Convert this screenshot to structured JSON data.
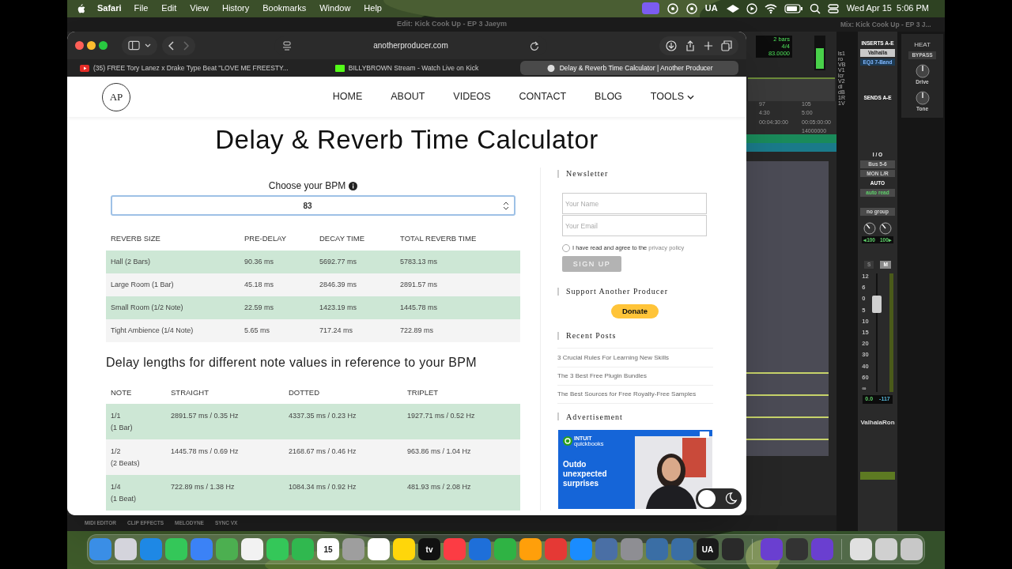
{
  "menu_bar": {
    "app": "Safari",
    "items": [
      "File",
      "Edit",
      "View",
      "History",
      "Bookmarks",
      "Window",
      "Help"
    ],
    "status_text": "UA",
    "clock": "Wed Apr 15  5:06 PM"
  },
  "daw": {
    "edit_title": "Edit: Kick Cook Up - EP 3 Jaeym",
    "mix_title": "Mix: Kick Cook Up - EP 3 J...",
    "counter": [
      "2 bars",
      "4/4",
      "83.0000"
    ],
    "ruler": [
      [
        "97",
        "105"
      ],
      [
        "4:30",
        "5:00"
      ],
      [
        "00:04:30:00",
        "00:05:00:00"
      ]
    ],
    "ruler_samples": "14000000",
    "track_fragments": [
      "ls1",
      "ro",
      "VB",
      "V1",
      "lcr",
      "V2",
      "dl",
      "dB",
      "1R",
      "1V"
    ],
    "inserts_header": "INSERTS A-E",
    "inserts": [
      "Valhalla",
      "EQ3 7-Band"
    ],
    "sends_header": "SENDS A-E",
    "io_header": "I / O",
    "io": [
      "Bus 5-6",
      "MON L/R"
    ],
    "auto_header": "AUTO",
    "auto": "auto read",
    "group": "no group",
    "pan": [
      "◂100",
      "100▸"
    ],
    "solo": "S",
    "mute": "M",
    "fader_scale": [
      "12",
      "6",
      "0",
      "5",
      "10",
      "15",
      "20",
      "30",
      "40",
      "60",
      "∞"
    ],
    "readout": [
      "0.0",
      "-117"
    ],
    "track_name": "ValhalaRon",
    "plugin": {
      "name": "HEAT",
      "bypass": "BYPASS",
      "knobs": [
        "Drive",
        "Tone"
      ]
    },
    "bottom_tabs": [
      "MIDI EDITOR",
      "CLIP EFFECTS",
      "MELODYNE",
      "SYNC VX"
    ]
  },
  "browser": {
    "address": "anotherproducer.com",
    "tabs": [
      {
        "kind": "video",
        "title": "(35) FREE Tory Lanez x Drake Type Beat \"LOVE ME FREESTY...",
        "selected": false
      },
      {
        "kind": "stream",
        "title": "BILLYBROWN Stream - Watch Live on Kick",
        "selected": false
      },
      {
        "kind": "site",
        "title": "Delay & Reverb Time Calculator | Another Producer",
        "selected": true
      }
    ]
  },
  "page": {
    "logo": "AP",
    "nav": [
      {
        "label": "HOME",
        "dropdown": false
      },
      {
        "label": "ABOUT",
        "dropdown": false
      },
      {
        "label": "VIDEOS",
        "dropdown": false
      },
      {
        "label": "CONTACT",
        "dropdown": false
      },
      {
        "label": "BLOG",
        "dropdown": false
      },
      {
        "label": "TOOLS",
        "dropdown": true
      }
    ],
    "title": "Delay & Reverb Time Calculator",
    "bpm": {
      "label": "Choose your BPM",
      "value": "83"
    },
    "reverb_table": {
      "columns": [
        "REVERB SIZE",
        "PRE-DELAY",
        "DECAY TIME",
        "TOTAL REVERB TIME"
      ],
      "rows": [
        [
          "Hall (2 Bars)",
          "90.36 ms",
          "5692.77 ms",
          "5783.13 ms"
        ],
        [
          "Large Room (1 Bar)",
          "45.18 ms",
          "2846.39 ms",
          "2891.57 ms"
        ],
        [
          "Small Room (1/2 Note)",
          "22.59 ms",
          "1423.19 ms",
          "1445.78 ms"
        ],
        [
          "Tight Ambience (1/4 Note)",
          "5.65 ms",
          "717.24 ms",
          "722.89 ms"
        ]
      ]
    },
    "delay_heading": "Delay lengths for different note values in reference to your BPM",
    "delay_table": {
      "columns": [
        "NOTE",
        "STRAIGHT",
        "DOTTED",
        "TRIPLET"
      ],
      "rows": [
        [
          "1/1\n(1 Bar)",
          "2891.57 ms / 0.35 Hz",
          "4337.35 ms / 0.23 Hz",
          "1927.71 ms / 0.52 Hz"
        ],
        [
          "1/2\n(2 Beats)",
          "1445.78 ms / 0.69 Hz",
          "2168.67 ms / 0.46 Hz",
          "963.86 ms / 1.04 Hz"
        ],
        [
          "1/4\n(1 Beat)",
          "722.89 ms / 1.38 Hz",
          "1084.34 ms / 0.92 Hz",
          "481.93 ms / 2.08 Hz"
        ]
      ]
    },
    "sidebar": {
      "newsletter": {
        "heading": "Newsletter",
        "name_placeholder": "Your Name",
        "email_placeholder": "Your Email",
        "consent": "I have read and agree to the",
        "consent_link": "privacy policy",
        "checked": false,
        "button": "SIGN UP"
      },
      "support": {
        "heading": "Support Another Producer",
        "button": "Donate"
      },
      "recent": {
        "heading": "Recent Posts",
        "posts": [
          "3 Crucial Rules For Learning New Skills",
          "The 3 Best Free Plugin Bundles",
          "The Best Sources for Free Royalty-Free Samples"
        ]
      },
      "ad": {
        "heading": "Advertisement",
        "brand_top": "INTUIT",
        "brand": "quickbooks",
        "headline": "Outdo unexpected surprises"
      }
    },
    "dark_mode": false
  },
  "dock": {
    "apps": [
      {
        "color": "#3a8ee6"
      },
      {
        "color": "#d4d4dc"
      },
      {
        "color": "#1e88e5"
      },
      {
        "color": "#34c759"
      },
      {
        "color": "#3b82f6"
      },
      {
        "color": "#4caf50"
      },
      {
        "color": "#f2f2f2"
      },
      {
        "color": "#34c759"
      },
      {
        "color": "#30b84f"
      },
      {
        "color": "#ffffff",
        "label": "15"
      },
      {
        "color": "#9e9e9e"
      },
      {
        "color": "#ffffff"
      },
      {
        "color": "#ffd60a"
      },
      {
        "color": "#111111",
        "label": "tv"
      },
      {
        "color": "#fc3c44"
      },
      {
        "color": "#1e6fd9"
      },
      {
        "color": "#2fb344"
      },
      {
        "color": "#ff9f0a"
      },
      {
        "color": "#e53935"
      },
      {
        "color": "#1a8cff"
      },
      {
        "color": "#4a6fa5"
      },
      {
        "color": "#8e8e93"
      },
      {
        "color": "#3a6ea5"
      },
      {
        "color": "#3a6ea5"
      },
      {
        "color": "#1a1a1a",
        "label": "UA"
      },
      {
        "color": "#2a2a2a"
      }
    ],
    "utilities": [
      {
        "color": "#6a3fd0"
      },
      {
        "color": "#333333"
      },
      {
        "color": "#6a3fd0"
      }
    ],
    "files": [
      {
        "color": "#e0e0e0"
      },
      {
        "color": "#d0d0d0"
      },
      {
        "color": "#c8c8c8"
      }
    ]
  }
}
